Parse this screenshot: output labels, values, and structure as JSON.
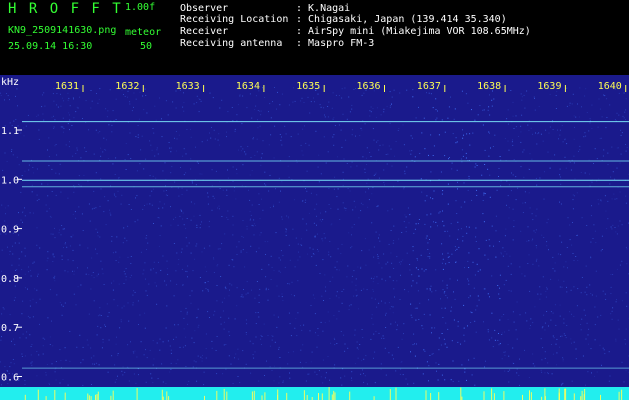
{
  "header": {
    "title": "H R O F F T",
    "version": "1.00f",
    "filename": "KN9_2509141630.png",
    "mode": "meteor",
    "timestamp": "25.09.14 16:30",
    "count": "50",
    "info": [
      {
        "label": "Observer",
        "value": ": K.Nagai"
      },
      {
        "label": "Receiving Location",
        "value": ": Chigasaki, Japan (139.414 35.340)"
      },
      {
        "label": "Receiver",
        "value": ": AirSpy mini (Miakejima VOR 108.65MHz)"
      },
      {
        "label": "Receiving antenna",
        "value": ": Maspro FM-3"
      }
    ]
  },
  "spectrogram": {
    "y_unit": "kHz",
    "time_ticks": [
      "1631",
      "1632",
      "1633",
      "1634",
      "1635",
      "1636",
      "1637",
      "1638",
      "1639",
      "1640"
    ],
    "freq_ticks": [
      "1.1",
      "1.0",
      "0.9",
      "0.8",
      "0.7",
      "0.6"
    ],
    "colors": {
      "background": "#1a1a8c",
      "noise": "#4477ff",
      "carrier": "#7ff0ff",
      "baseline": "#22eeee",
      "tick_label": "#ffff55",
      "axis_label": "#ffffff"
    }
  }
}
